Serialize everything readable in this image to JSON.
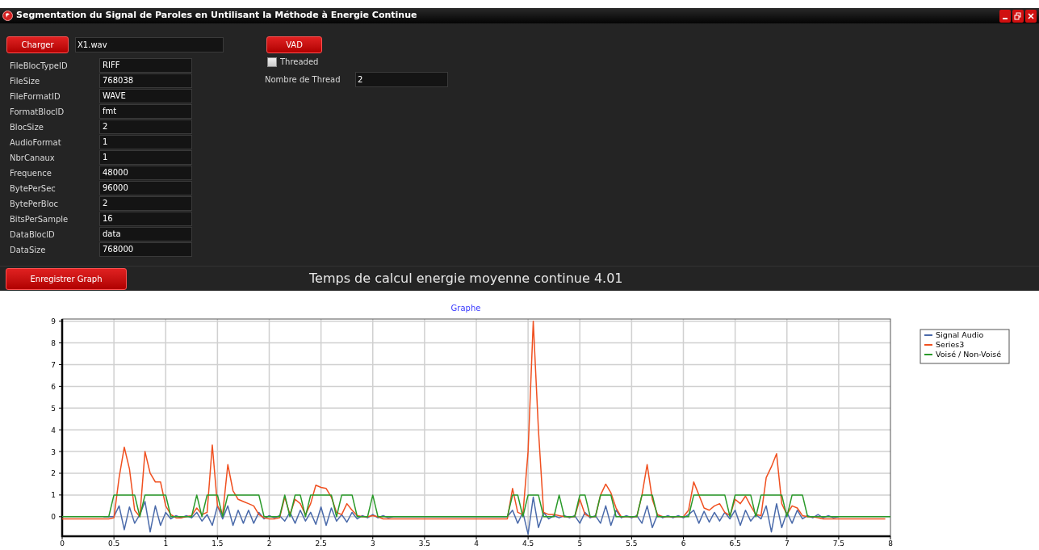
{
  "window": {
    "title": "Segmentation du Signal de Paroles en Untilisant la Méthode à Energie Continue"
  },
  "file": {
    "load_button": "Charger",
    "filename": "X1.wav"
  },
  "header_fields": [
    {
      "label": "FileBlocTypeID",
      "value": "RIFF"
    },
    {
      "label": "FileSize",
      "value": "768038"
    },
    {
      "label": "FileFormatID",
      "value": "WAVE"
    },
    {
      "label": "FormatBlocID",
      "value": "fmt"
    },
    {
      "label": "BlocSize",
      "value": "2"
    },
    {
      "label": "AudioFormat",
      "value": "1"
    },
    {
      "label": "NbrCanaux",
      "value": "1"
    },
    {
      "label": "Frequence",
      "value": "48000"
    },
    {
      "label": "BytePerSec",
      "value": "96000"
    },
    {
      "label": "BytePerBloc",
      "value": "2"
    },
    {
      "label": "BitsPerSample",
      "value": "16"
    },
    {
      "label": "DataBlocID",
      "value": "data"
    },
    {
      "label": "DataSize",
      "value": "768000"
    }
  ],
  "vad": {
    "button": "VAD",
    "threaded": {
      "label": "Threaded",
      "checked": false
    },
    "thread_count": {
      "label": "Nombre de Thread",
      "value": "2"
    }
  },
  "save_button": "Enregistrer Graph",
  "status": "Temps de calcul energie moyenne continue 4.01",
  "graph": {
    "chart_data": {
      "type": "line",
      "title": "Graphe",
      "grid": true,
      "legend": true,
      "xlim": [
        0,
        8
      ],
      "ylim": [
        -0.9,
        9.1
      ],
      "xticks": [
        0,
        0.5,
        1,
        1.5,
        2,
        2.5,
        3,
        3.5,
        4,
        4.5,
        5,
        5.5,
        6,
        6.5,
        7,
        7.5,
        8
      ],
      "yticks": [
        0,
        1,
        2,
        3,
        4,
        5,
        6,
        7,
        8,
        9
      ],
      "x": [
        0,
        0.05,
        0.1,
        0.15,
        0.2,
        0.25,
        0.3,
        0.35,
        0.4,
        0.45,
        0.5,
        0.55,
        0.6,
        0.65,
        0.7,
        0.75,
        0.8,
        0.85,
        0.9,
        0.95,
        1,
        1.05,
        1.1,
        1.15,
        1.2,
        1.25,
        1.3,
        1.35,
        1.4,
        1.45,
        1.5,
        1.55,
        1.6,
        1.65,
        1.7,
        1.75,
        1.8,
        1.85,
        1.9,
        1.95,
        2,
        2.05,
        2.1,
        2.15,
        2.2,
        2.25,
        2.3,
        2.35,
        2.4,
        2.45,
        2.5,
        2.55,
        2.6,
        2.65,
        2.7,
        2.75,
        2.8,
        2.85,
        2.9,
        2.95,
        3,
        3.05,
        3.1,
        3.15,
        3.2,
        3.25,
        3.3,
        3.35,
        3.4,
        3.45,
        3.5,
        3.55,
        3.6,
        3.65,
        3.7,
        3.75,
        3.8,
        3.85,
        3.9,
        3.95,
        4,
        4.05,
        4.1,
        4.15,
        4.2,
        4.25,
        4.3,
        4.35,
        4.4,
        4.45,
        4.5,
        4.55,
        4.6,
        4.65,
        4.7,
        4.75,
        4.8,
        4.85,
        4.9,
        4.95,
        5,
        5.05,
        5.1,
        5.15,
        5.2,
        5.25,
        5.3,
        5.35,
        5.4,
        5.45,
        5.5,
        5.55,
        5.6,
        5.65,
        5.7,
        5.75,
        5.8,
        5.85,
        5.9,
        5.95,
        6,
        6.05,
        6.1,
        6.15,
        6.2,
        6.25,
        6.3,
        6.35,
        6.4,
        6.45,
        6.5,
        6.55,
        6.6,
        6.65,
        6.7,
        6.75,
        6.8,
        6.85,
        6.9,
        6.95,
        7,
        7.05,
        7.1,
        7.15,
        7.2,
        7.25,
        7.3,
        7.35,
        7.4,
        7.45,
        7.5,
        7.55,
        7.6,
        7.65,
        7.7,
        7.75,
        7.8,
        7.85,
        7.9,
        7.95,
        8
      ],
      "series": [
        {
          "name": "Signal Audio",
          "color": "#4a6aaa",
          "values": [
            null,
            null,
            null,
            null,
            null,
            null,
            null,
            null,
            0,
            0,
            0,
            0.5,
            -0.6,
            0.45,
            -0.3,
            0.1,
            0.7,
            -0.7,
            0.5,
            -0.4,
            0.2,
            -0.1,
            0.05,
            -0.05,
            0.05,
            -0.05,
            0.2,
            -0.2,
            0.1,
            -0.4,
            0.5,
            -0.1,
            0.5,
            -0.4,
            0.3,
            -0.3,
            0.3,
            -0.3,
            0.2,
            -0.1,
            0.05,
            -0.05,
            0.05,
            -0.2,
            0.2,
            -0.3,
            0.3,
            -0.2,
            0.2,
            -0.35,
            0.45,
            -0.4,
            0.4,
            -0.2,
            0.1,
            -0.25,
            0.2,
            -0.1,
            0.05,
            -0.05,
            0.1,
            -0.05,
            0.05,
            -0.05,
            0,
            0,
            0,
            0,
            0,
            0,
            0,
            0,
            0,
            0,
            0,
            0,
            0,
            0,
            0,
            0,
            0,
            0,
            0,
            0,
            0,
            0,
            0,
            0.3,
            -0.3,
            0.2,
            -0.8,
            0.9,
            -0.5,
            0.2,
            -0.1,
            0.05,
            -0.05,
            0.05,
            -0.05,
            0.05,
            -0.3,
            0.2,
            -0.05,
            0.05,
            -0.3,
            0.5,
            -0.4,
            0.3,
            -0.05,
            0.05,
            -0.05,
            0.05,
            -0.3,
            0.5,
            -0.5,
            0.1,
            -0.05,
            0.05,
            -0.05,
            0.05,
            -0.05,
            0.1,
            0.3,
            -0.3,
            0.25,
            -0.25,
            0.2,
            -0.2,
            0.2,
            -0.1,
            0.3,
            -0.4,
            0.3,
            -0.2,
            0.1,
            -0.1,
            0.5,
            -0.7,
            0.6,
            -0.5,
            0.2,
            -0.3,
            0.3,
            -0.1,
            0.05,
            -0.05,
            0.1,
            -0.05,
            0.05,
            -0.05,
            0,
            null,
            null,
            null,
            null,
            null,
            null,
            null,
            null,
            null,
            null
          ]
        },
        {
          "name": "Series3",
          "color": "#f05020",
          "values": [
            -0.1,
            -0.1,
            -0.1,
            -0.1,
            -0.1,
            -0.1,
            -0.1,
            -0.1,
            -0.1,
            -0.1,
            -0.05,
            1.8,
            3.2,
            2.2,
            0.3,
            0,
            3.0,
            2.0,
            1.6,
            1.6,
            0.5,
            0.1,
            -0.05,
            -0.05,
            0,
            0.05,
            0.4,
            0.1,
            0.2,
            3.3,
            0.5,
            0.1,
            2.4,
            1.2,
            0.8,
            0.7,
            0.6,
            0.5,
            0.1,
            -0.05,
            -0.1,
            -0.1,
            -0.05,
            0.9,
            0.1,
            0.8,
            0.6,
            0.1,
            0.6,
            1.45,
            1.35,
            1.3,
            0.9,
            0.2,
            0.1,
            0.6,
            0.3,
            0.05,
            0,
            0,
            0.05,
            0,
            -0.1,
            -0.1,
            -0.1,
            -0.1,
            -0.1,
            -0.1,
            -0.1,
            -0.1,
            -0.1,
            -0.1,
            -0.1,
            -0.1,
            -0.1,
            -0.1,
            -0.1,
            -0.1,
            -0.1,
            -0.1,
            -0.1,
            -0.1,
            -0.1,
            -0.1,
            -0.1,
            -0.1,
            -0.1,
            1.3,
            0.2,
            0.1,
            3.0,
            9.0,
            4.0,
            0.2,
            0.1,
            0.1,
            0.05,
            0,
            0,
            0,
            0.8,
            0.1,
            0,
            0,
            1.0,
            1.5,
            1.1,
            0.4,
            0,
            0,
            0,
            0,
            1.0,
            2.4,
            0.8,
            0.1,
            0,
            0,
            0,
            0,
            0,
            0.3,
            1.6,
            1.0,
            0.4,
            0.3,
            0.5,
            0.6,
            0.2,
            0.05,
            0.8,
            0.6,
            0.95,
            0.5,
            0.1,
            0.05,
            1.8,
            2.3,
            2.9,
            0.6,
            0.1,
            0.5,
            0.4,
            0.05,
            0,
            0,
            -0.05,
            -0.1,
            -0.1,
            -0.1,
            -0.1,
            -0.1,
            -0.1,
            -0.1,
            -0.1,
            -0.1,
            -0.1,
            -0.1,
            -0.1,
            -0.1,
            null
          ]
        },
        {
          "name": "Voisé / Non-Voisé",
          "color": "#2a9a2a",
          "values": [
            0,
            0,
            0,
            0,
            0,
            0,
            0,
            0,
            0,
            0,
            1,
            1,
            1,
            1,
            1,
            0,
            1,
            1,
            1,
            1,
            1,
            0,
            0,
            0,
            0,
            0,
            1,
            0,
            1,
            1,
            1,
            0,
            1,
            1,
            1,
            1,
            1,
            1,
            1,
            0,
            0,
            0,
            0,
            1,
            0,
            1,
            1,
            0,
            1,
            1,
            1,
            1,
            1,
            0,
            1,
            1,
            1,
            0,
            0,
            0,
            1,
            0,
            0,
            0,
            0,
            0,
            0,
            0,
            0,
            0,
            0,
            0,
            0,
            0,
            0,
            0,
            0,
            0,
            0,
            0,
            0,
            0,
            0,
            0,
            0,
            0,
            0,
            1,
            1,
            0,
            1,
            1,
            1,
            0,
            0,
            0,
            1,
            0,
            0,
            0,
            1,
            1,
            0,
            0,
            1,
            1,
            1,
            0,
            0,
            0,
            0,
            0,
            1,
            1,
            1,
            0,
            0,
            0,
            0,
            0,
            0,
            0,
            1,
            1,
            1,
            1,
            1,
            1,
            1,
            0,
            1,
            1,
            1,
            1,
            0,
            1,
            1,
            1,
            1,
            1,
            0,
            1,
            1,
            1,
            0,
            0,
            0,
            0,
            0,
            0,
            0,
            0,
            0,
            0,
            0,
            0,
            0,
            0,
            0,
            0,
            0
          ]
        }
      ]
    }
  }
}
